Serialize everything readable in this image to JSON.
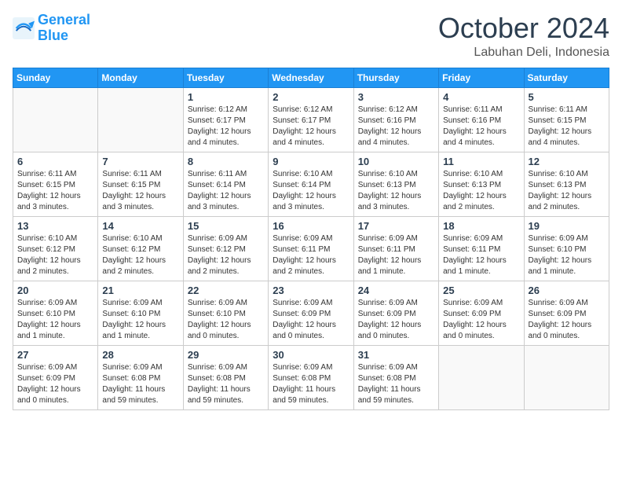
{
  "logo": {
    "line1": "General",
    "line2": "Blue"
  },
  "title": "October 2024",
  "location": "Labuhan Deli, Indonesia",
  "columns": [
    "Sunday",
    "Monday",
    "Tuesday",
    "Wednesday",
    "Thursday",
    "Friday",
    "Saturday"
  ],
  "weeks": [
    [
      {
        "day": "",
        "info": ""
      },
      {
        "day": "",
        "info": ""
      },
      {
        "day": "1",
        "info": "Sunrise: 6:12 AM\nSunset: 6:17 PM\nDaylight: 12 hours\nand 4 minutes."
      },
      {
        "day": "2",
        "info": "Sunrise: 6:12 AM\nSunset: 6:17 PM\nDaylight: 12 hours\nand 4 minutes."
      },
      {
        "day": "3",
        "info": "Sunrise: 6:12 AM\nSunset: 6:16 PM\nDaylight: 12 hours\nand 4 minutes."
      },
      {
        "day": "4",
        "info": "Sunrise: 6:11 AM\nSunset: 6:16 PM\nDaylight: 12 hours\nand 4 minutes."
      },
      {
        "day": "5",
        "info": "Sunrise: 6:11 AM\nSunset: 6:15 PM\nDaylight: 12 hours\nand 4 minutes."
      }
    ],
    [
      {
        "day": "6",
        "info": "Sunrise: 6:11 AM\nSunset: 6:15 PM\nDaylight: 12 hours\nand 3 minutes."
      },
      {
        "day": "7",
        "info": "Sunrise: 6:11 AM\nSunset: 6:15 PM\nDaylight: 12 hours\nand 3 minutes."
      },
      {
        "day": "8",
        "info": "Sunrise: 6:11 AM\nSunset: 6:14 PM\nDaylight: 12 hours\nand 3 minutes."
      },
      {
        "day": "9",
        "info": "Sunrise: 6:10 AM\nSunset: 6:14 PM\nDaylight: 12 hours\nand 3 minutes."
      },
      {
        "day": "10",
        "info": "Sunrise: 6:10 AM\nSunset: 6:13 PM\nDaylight: 12 hours\nand 3 minutes."
      },
      {
        "day": "11",
        "info": "Sunrise: 6:10 AM\nSunset: 6:13 PM\nDaylight: 12 hours\nand 2 minutes."
      },
      {
        "day": "12",
        "info": "Sunrise: 6:10 AM\nSunset: 6:13 PM\nDaylight: 12 hours\nand 2 minutes."
      }
    ],
    [
      {
        "day": "13",
        "info": "Sunrise: 6:10 AM\nSunset: 6:12 PM\nDaylight: 12 hours\nand 2 minutes."
      },
      {
        "day": "14",
        "info": "Sunrise: 6:10 AM\nSunset: 6:12 PM\nDaylight: 12 hours\nand 2 minutes."
      },
      {
        "day": "15",
        "info": "Sunrise: 6:09 AM\nSunset: 6:12 PM\nDaylight: 12 hours\nand 2 minutes."
      },
      {
        "day": "16",
        "info": "Sunrise: 6:09 AM\nSunset: 6:11 PM\nDaylight: 12 hours\nand 2 minutes."
      },
      {
        "day": "17",
        "info": "Sunrise: 6:09 AM\nSunset: 6:11 PM\nDaylight: 12 hours\nand 1 minute."
      },
      {
        "day": "18",
        "info": "Sunrise: 6:09 AM\nSunset: 6:11 PM\nDaylight: 12 hours\nand 1 minute."
      },
      {
        "day": "19",
        "info": "Sunrise: 6:09 AM\nSunset: 6:10 PM\nDaylight: 12 hours\nand 1 minute."
      }
    ],
    [
      {
        "day": "20",
        "info": "Sunrise: 6:09 AM\nSunset: 6:10 PM\nDaylight: 12 hours\nand 1 minute."
      },
      {
        "day": "21",
        "info": "Sunrise: 6:09 AM\nSunset: 6:10 PM\nDaylight: 12 hours\nand 1 minute."
      },
      {
        "day": "22",
        "info": "Sunrise: 6:09 AM\nSunset: 6:10 PM\nDaylight: 12 hours\nand 0 minutes."
      },
      {
        "day": "23",
        "info": "Sunrise: 6:09 AM\nSunset: 6:09 PM\nDaylight: 12 hours\nand 0 minutes."
      },
      {
        "day": "24",
        "info": "Sunrise: 6:09 AM\nSunset: 6:09 PM\nDaylight: 12 hours\nand 0 minutes."
      },
      {
        "day": "25",
        "info": "Sunrise: 6:09 AM\nSunset: 6:09 PM\nDaylight: 12 hours\nand 0 minutes."
      },
      {
        "day": "26",
        "info": "Sunrise: 6:09 AM\nSunset: 6:09 PM\nDaylight: 12 hours\nand 0 minutes."
      }
    ],
    [
      {
        "day": "27",
        "info": "Sunrise: 6:09 AM\nSunset: 6:09 PM\nDaylight: 12 hours\nand 0 minutes."
      },
      {
        "day": "28",
        "info": "Sunrise: 6:09 AM\nSunset: 6:08 PM\nDaylight: 11 hours\nand 59 minutes."
      },
      {
        "day": "29",
        "info": "Sunrise: 6:09 AM\nSunset: 6:08 PM\nDaylight: 11 hours\nand 59 minutes."
      },
      {
        "day": "30",
        "info": "Sunrise: 6:09 AM\nSunset: 6:08 PM\nDaylight: 11 hours\nand 59 minutes."
      },
      {
        "day": "31",
        "info": "Sunrise: 6:09 AM\nSunset: 6:08 PM\nDaylight: 11 hours\nand 59 minutes."
      },
      {
        "day": "",
        "info": ""
      },
      {
        "day": "",
        "info": ""
      }
    ]
  ]
}
